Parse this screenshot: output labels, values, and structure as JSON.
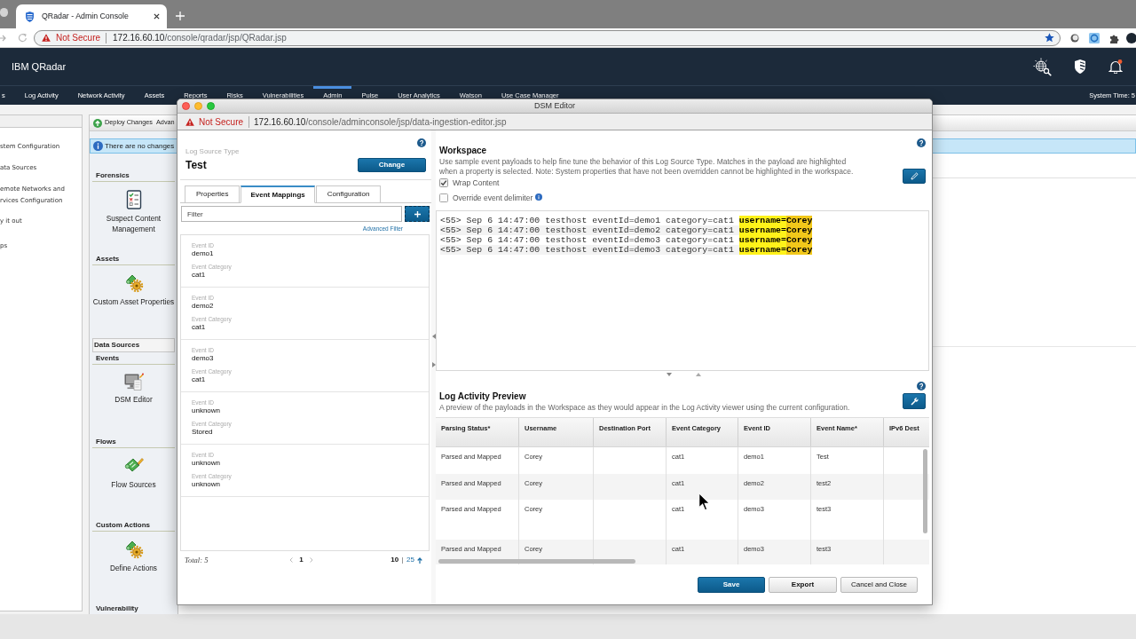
{
  "browser": {
    "tab": {
      "title": "QRadar - Admin Console"
    },
    "address_bar": {
      "security_label": "Not Secure",
      "host": "172.16.60.10",
      "path": "/console/qradar/jsp/QRadar.jsp"
    }
  },
  "app_header": {
    "title": "IBM QRadar"
  },
  "nav": {
    "tabs": [
      {
        "label": "s",
        "selected": false
      },
      {
        "label": "Log Activity",
        "selected": false
      },
      {
        "label": "Network Activity",
        "selected": false
      },
      {
        "label": "Assets",
        "selected": false
      },
      {
        "label": "Reports",
        "selected": false
      },
      {
        "label": "Risks",
        "selected": false
      },
      {
        "label": "Vulnerabilities",
        "selected": false
      },
      {
        "label": "Admin",
        "selected": true
      },
      {
        "label": "Pulse",
        "selected": false
      },
      {
        "label": "User Analytics",
        "selected": false
      },
      {
        "label": "Watson",
        "selected": false
      },
      {
        "label": "Use Case Manager",
        "selected": false
      }
    ],
    "system_time": "System Time: 5"
  },
  "admin_sidebar": {
    "items": [
      {
        "lines": [
          "stem Configuration"
        ]
      },
      {
        "lines": [
          "ata Sources"
        ]
      },
      {
        "lines": [
          "emote Networks and",
          "rvices Configuration"
        ]
      },
      {
        "lines": [
          "y it out"
        ]
      },
      {
        "lines": [
          "ps"
        ]
      }
    ]
  },
  "admin_panel": {
    "toolbar": {
      "deploy_button": "Deploy Changes",
      "advanced_button": "Advan"
    },
    "message": "There are no changes",
    "sections": [
      {
        "kind": "heading",
        "title": "Forensics",
        "items": [
          {
            "kind": "checklist",
            "label": "Suspect Content Management"
          }
        ]
      },
      {
        "kind": "heading",
        "title": "Assets",
        "items": [
          {
            "kind": "scroll-gear",
            "label": "Custom Asset Properties"
          }
        ]
      },
      {
        "kind": "category",
        "title": "Data Sources"
      },
      {
        "kind": "heading",
        "title": "Events",
        "items": [
          {
            "kind": "monitor-note",
            "label": "DSM Editor"
          }
        ]
      },
      {
        "kind": "heading",
        "title": "Flows",
        "items": [
          {
            "kind": "scroll-pencil",
            "label": "Flow Sources"
          }
        ]
      },
      {
        "kind": "heading",
        "title": "Custom Actions",
        "items": [
          {
            "kind": "scroll-gear",
            "label": "Define Actions"
          }
        ]
      },
      {
        "kind": "heading",
        "title": "Vulnerability"
      }
    ]
  },
  "dsm_editor": {
    "title": "DSM Editor",
    "address_bar": {
      "security_label": "Not Secure",
      "host": "172.16.60.10",
      "path": "/console/adminconsole/jsp/data-ingestion-editor.jsp"
    },
    "log_source_type": {
      "label": "Log Source Type",
      "value": "Test",
      "change_button": "Change"
    },
    "tabs": [
      {
        "label": "Properties",
        "selected": false
      },
      {
        "label": "Event Mappings",
        "selected": true
      },
      {
        "label": "Configuration",
        "selected": false
      }
    ],
    "filter": {
      "placeholder": "Filter"
    },
    "advanced_filter_link": "Advanced Filter",
    "event_mappings": [
      {
        "fields": [
          {
            "label": "Event ID",
            "value": "demo1"
          },
          {
            "label": "Event Category",
            "value": "cat1"
          }
        ]
      },
      {
        "fields": [
          {
            "label": "Event ID",
            "value": "demo2"
          },
          {
            "label": "Event Category",
            "value": "cat1"
          }
        ]
      },
      {
        "fields": [
          {
            "label": "Event ID",
            "value": "demo3"
          },
          {
            "label": "Event Category",
            "value": "cat1"
          }
        ]
      },
      {
        "fields": [
          {
            "label": "Event ID",
            "value": "unknown"
          },
          {
            "label": "Event Category",
            "value": "Stored"
          }
        ]
      },
      {
        "fields": [
          {
            "label": "Event ID",
            "value": "unknown"
          },
          {
            "label": "Event Category",
            "value": "unknown"
          }
        ]
      }
    ],
    "list_footer": {
      "total": "Total: 5",
      "current_page": "1",
      "page_sizes": [
        {
          "label": "10",
          "selected": true
        },
        {
          "label": "25",
          "selected": false
        }
      ]
    },
    "workspace": {
      "title": "Workspace",
      "description": "Use sample event payloads to help fine tune the behavior of this Log Source Type. Matches in the payload are highlighted when a property is selected. Note: System properties that have not been overridden cannot be highlighted in the workspace.",
      "options": [
        {
          "label": "Wrap Content",
          "checked": true,
          "has_info": false
        },
        {
          "label": "Override event delimiter",
          "checked": false,
          "has_info": true
        }
      ],
      "payloads": [
        {
          "segments": [
            {
              "kind": "plain",
              "text": "<55> Sep 6 14:47:00 testhost eventId=demo1 category=cat1"
            },
            {
              "kind": "match",
              "text": "username="
            },
            {
              "kind": "capture",
              "text": "Corey"
            }
          ]
        },
        {
          "segments": [
            {
              "kind": "plain",
              "text": "<55> Sep 6 14:47:00 testhost eventId=demo2 category=cat1"
            },
            {
              "kind": "match",
              "text": "username="
            },
            {
              "kind": "capture",
              "text": "Corey"
            }
          ]
        },
        {
          "segments": [
            {
              "kind": "plain",
              "text": "<55> Sep 6 14:47:00 testhost eventId=demo3 category=cat1"
            },
            {
              "kind": "match",
              "text": "username="
            },
            {
              "kind": "capture",
              "text": "Corey"
            }
          ]
        },
        {
          "segments": [
            {
              "kind": "plain",
              "text": "<55> Sep 6 14:47:00 testhost eventId=demo3 category=cat1"
            },
            {
              "kind": "match",
              "text": "username="
            },
            {
              "kind": "capture",
              "text": "Corey"
            }
          ]
        }
      ]
    },
    "preview": {
      "title": "Log Activity Preview",
      "description": "A preview of the payloads in the Workspace as they would appear in the Log Activity viewer using the current configuration.",
      "table": {
        "columns": [
          "Parsing Status*",
          "Username",
          "Destination Port",
          "Event Category",
          "Event ID",
          "Event Name*",
          "IPv6 Dest"
        ],
        "rows": [
          [
            "Parsed and Mapped",
            "Corey",
            null,
            "cat1",
            "demo1",
            "Test",
            null
          ],
          [
            "Parsed and Mapped",
            "Corey",
            null,
            "cat1",
            "demo2",
            "test2",
            null
          ],
          [
            "Parsed and Mapped",
            "Corey",
            null,
            "cat1",
            "demo3",
            "test3",
            null
          ],
          [
            "Parsed and Mapped",
            "Corey",
            null,
            "cat1",
            "demo3",
            "test3",
            null
          ]
        ]
      }
    },
    "buttons": [
      {
        "label": "Save",
        "kind": "primary"
      },
      {
        "label": "Export",
        "kind": "emphasized"
      },
      {
        "label": "Cancel and Close",
        "kind": "plain"
      }
    ]
  }
}
